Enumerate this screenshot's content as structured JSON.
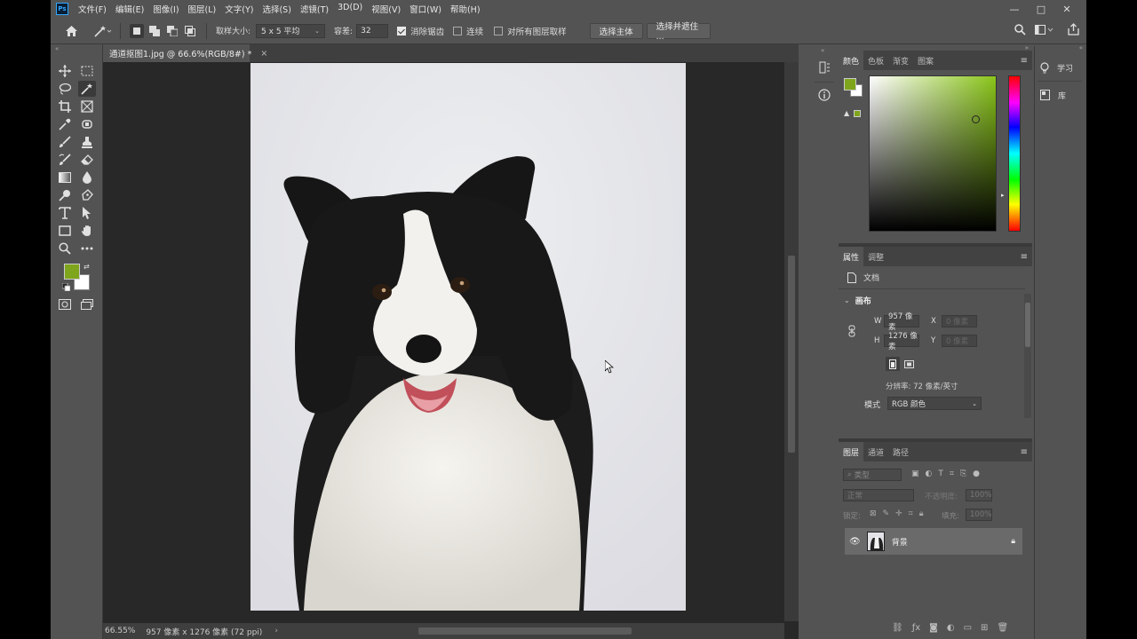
{
  "app": {
    "logo": "Ps"
  },
  "menu": [
    "文件(F)",
    "编辑(E)",
    "图像(I)",
    "图层(L)",
    "文字(Y)",
    "选择(S)",
    "滤镜(T)",
    "3D(D)",
    "视图(V)",
    "窗口(W)",
    "帮助(H)"
  ],
  "window_controls": {
    "minimize": "—",
    "maximize": "□",
    "close": "✕"
  },
  "options": {
    "sample_size_label": "取样大小:",
    "sample_size_value": "5 x 5 平均",
    "tolerance_label": "容差:",
    "tolerance_value": "32",
    "antialias_label": "消除锯齿",
    "antialias_checked": true,
    "contiguous_label": "连续",
    "contiguous_checked": false,
    "all_layers_label": "对所有图层取样",
    "all_layers_checked": false,
    "select_subject_label": "选择主体",
    "select_mask_label": "选择并遮住 ..."
  },
  "document": {
    "tab_title": "通道抠图1.jpg @ 66.6%(RGB/8#) *",
    "tab_close": "×"
  },
  "status": {
    "zoom": "66.55%",
    "info": "957 像素 x 1276 像素 (72 ppi)",
    "arrow": "›"
  },
  "colors": {
    "foreground": "#7fa51c",
    "background": "#ffffff",
    "hue_color": "#8ac51a"
  },
  "color_panel": {
    "tabs": [
      "颜色",
      "色板",
      "渐变",
      "图案"
    ],
    "active": 0
  },
  "properties_panel": {
    "tabs": [
      "属性",
      "调整"
    ],
    "active": 0,
    "doc_label": "文档",
    "section_title": "画布",
    "width_label": "W",
    "width_value": "957 像素",
    "height_label": "H",
    "height_value": "1276 像素",
    "x_label": "X",
    "x_placeholder": "0 像素",
    "y_label": "Y",
    "y_placeholder": "0 像素",
    "resolution": "分辨率: 72 像素/英寸",
    "mode_label": "模式",
    "mode_value": "RGB 颜色"
  },
  "layers_panel": {
    "tabs": [
      "图层",
      "通道",
      "路径"
    ],
    "active": 0,
    "search_placeholder": "类型",
    "blend_mode": "正常",
    "opacity_label": "不透明度:",
    "opacity_value": "100%",
    "lock_label": "锁定:",
    "fill_label": "填充:",
    "fill_value": "100%",
    "layer_name": "背景"
  },
  "learn_panel": {
    "learn": "学习",
    "library": "库"
  }
}
